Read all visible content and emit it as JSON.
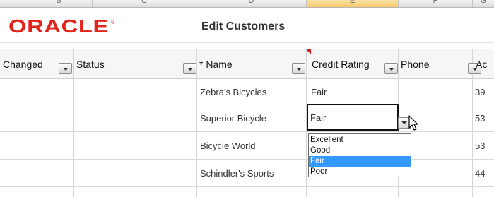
{
  "window": {
    "brand": "ORACLE",
    "title": "Edit Customers"
  },
  "spreadsheet_columns": [
    "B",
    "C",
    "D",
    "E",
    "F",
    "G"
  ],
  "table": {
    "headers": [
      "Changed",
      "Status",
      "* Name",
      "Credit Rating",
      "Phone",
      "Ac"
    ],
    "rows": [
      {
        "name": "Zebra's Bicycles",
        "credit": "Fair",
        "account": "39"
      },
      {
        "name": "Superior Bicycle",
        "credit": "Fair",
        "account": "53"
      },
      {
        "name": "Bicycle World",
        "credit": "",
        "account": "53"
      },
      {
        "name": "Schindler's Sports",
        "credit": "",
        "account": "44"
      }
    ]
  },
  "credit_dropdown": {
    "current_value": "Fair",
    "options": [
      "Excellent",
      "Good",
      "Fair",
      "Poor"
    ],
    "selected": "Fair"
  },
  "colors": {
    "brand_red": "#e2231a",
    "selection_blue": "#3399ff",
    "comment_indicator": "#d42020",
    "selected_column_header": "#f5c766"
  }
}
